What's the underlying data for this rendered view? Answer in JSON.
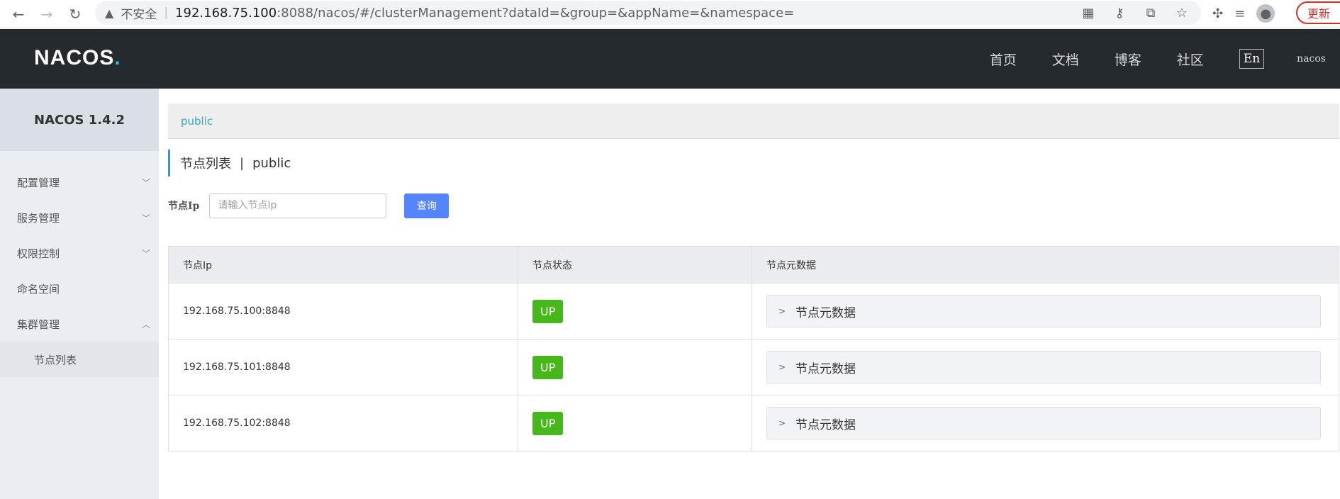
{
  "browser": {
    "insecure_label": "不安全",
    "url_host": "192.168.75.100",
    "url_rest": ":8088/nacos/#/clusterManagement?dataId=&group=&appName=&namespace=",
    "update_label": "更新"
  },
  "header": {
    "logo_main": "NACOS",
    "logo_dot": ".",
    "nav": [
      "首页",
      "文档",
      "博客",
      "社区"
    ],
    "lang": "En",
    "user": "nacos"
  },
  "sidebar": {
    "version": "NACOS 1.4.2",
    "items": [
      {
        "label": "配置管理",
        "chevron": "﹀"
      },
      {
        "label": "服务管理",
        "chevron": "﹀"
      },
      {
        "label": "权限控制",
        "chevron": "﹀"
      },
      {
        "label": "命名空间",
        "chevron": ""
      },
      {
        "label": "集群管理",
        "chevron": "︿"
      }
    ],
    "sub_item": "节点列表"
  },
  "main": {
    "namespace": "public",
    "title": "节点列表",
    "title_sep": "|",
    "title_ns": "public",
    "search_label": "节点Ip",
    "search_placeholder": "请输入节点Ip",
    "query_label": "查询",
    "columns": [
      "节点Ip",
      "节点状态",
      "节点元数据"
    ],
    "rows": [
      {
        "ip": "192.168.75.100:8848",
        "status": "UP",
        "meta": "节点元数据"
      },
      {
        "ip": "192.168.75.101:8848",
        "status": "UP",
        "meta": "节点元数据"
      },
      {
        "ip": "192.168.75.102:8848",
        "status": "UP",
        "meta": "节点元数据"
      }
    ]
  },
  "colors": {
    "header_bg": "#252a2f",
    "accent": "#209bfa",
    "button": "#5584ff",
    "status_up": "#46b81a"
  }
}
